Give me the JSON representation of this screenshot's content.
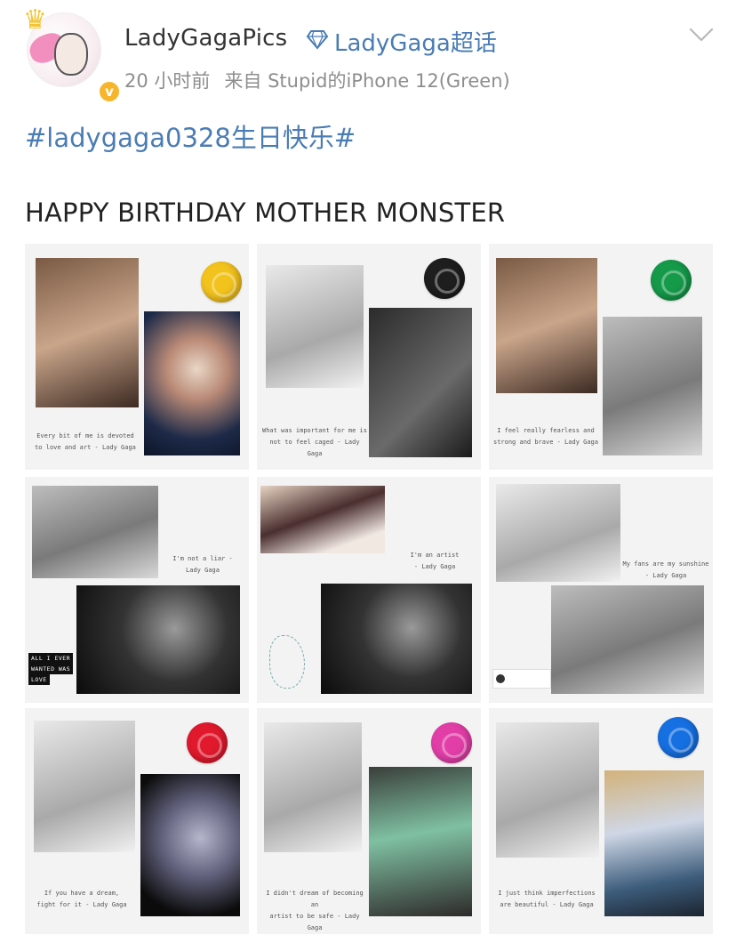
{
  "header": {
    "username": "LadyGagaPics",
    "topic": "LadyGaga超话",
    "time": "20 小时前",
    "source": "来自 Stupid的iPhone 12(Green)"
  },
  "post": {
    "hashtag": "#ladygaga0328生日快乐#",
    "text": "HAPPY BIRTHDAY MOTHER MONSTER"
  },
  "colors": {
    "link": "#4a7cb4",
    "seal_yellow": "#f2c21d",
    "seal_black": "#1e1e1e",
    "seal_green": "#159a4a",
    "seal_red": "#e0192d",
    "seal_pink": "#e23ea8",
    "seal_blue": "#1670e2"
  },
  "tiles": [
    {
      "quote": "Every bit of me is devoted\nto love and art - Lady Gaga"
    },
    {
      "quote": "What was important for me is\nnot to feel caged - Lady Gaga"
    },
    {
      "quote": "I feel really fearless and\nstrong and brave - Lady Gaga"
    },
    {
      "quote": "I'm not a liar -\nLady Gaga",
      "ribbon": [
        "ALL I EVER",
        "WANTED WAS",
        "LOVE"
      ]
    },
    {
      "quote": "I'm an artist\n- Lady Gaga"
    },
    {
      "quote": "My fans are my sunshine\n- Lady Gaga"
    },
    {
      "quote": "If you have a dream,\nfight for it - Lady Gaga"
    },
    {
      "quote": "I didn't dream of becoming an\nartist to be safe - Lady Gaga"
    },
    {
      "quote": "I just think imperfections\nare beautiful - Lady Gaga"
    }
  ]
}
